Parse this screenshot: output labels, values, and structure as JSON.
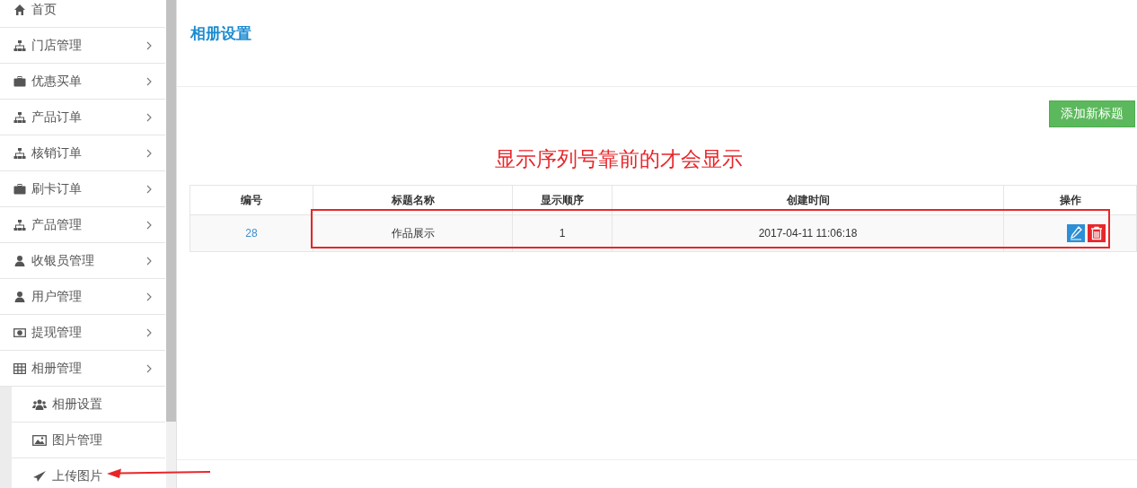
{
  "sidebar": {
    "items": [
      {
        "label": "首页",
        "kind": "home",
        "expandable": false
      },
      {
        "label": "门店管理",
        "kind": "sitemap",
        "expandable": true
      },
      {
        "label": "优惠买单",
        "kind": "briefcase",
        "expandable": true
      },
      {
        "label": "产品订单",
        "kind": "sitemap",
        "expandable": true
      },
      {
        "label": "核销订单",
        "kind": "sitemap",
        "expandable": true
      },
      {
        "label": "刷卡订单",
        "kind": "briefcase",
        "expandable": true
      },
      {
        "label": "产品管理",
        "kind": "sitemap",
        "expandable": true
      },
      {
        "label": "收银员管理",
        "kind": "user",
        "expandable": true
      },
      {
        "label": "用户管理",
        "kind": "user",
        "expandable": true
      },
      {
        "label": "提现管理",
        "kind": "money",
        "expandable": true
      },
      {
        "label": "相册管理",
        "kind": "table",
        "expandable": true,
        "children": [
          {
            "label": "相册设置",
            "kind": "users"
          },
          {
            "label": "图片管理",
            "kind": "image"
          },
          {
            "label": "上传图片",
            "kind": "send"
          }
        ]
      }
    ]
  },
  "page_title": "相册设置",
  "add_button": "添加新标题",
  "annotation": "显示序列号靠前的才会显示",
  "table": {
    "columns": [
      "编号",
      "标题名称",
      "显示顺序",
      "创建时间",
      "操作"
    ],
    "rows": [
      {
        "id": "28",
        "title": "作品展示",
        "order": "1",
        "created": "2017-04-11 11:06:18"
      }
    ]
  }
}
